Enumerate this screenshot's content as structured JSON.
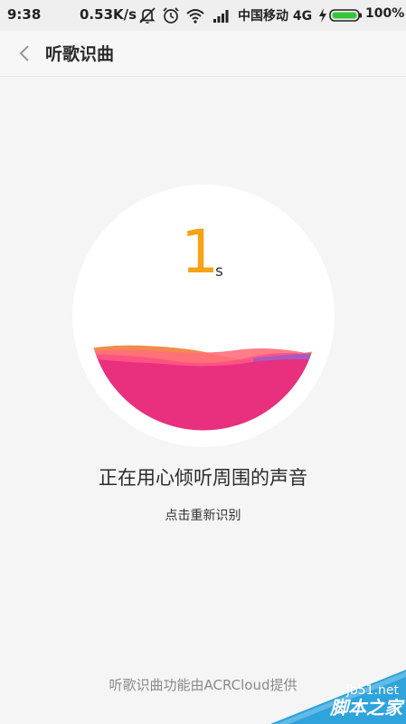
{
  "status_bar": {
    "time": "9:38",
    "net_speed": "0.53K/s",
    "carrier": "中国移动 4G",
    "battery": "100%",
    "icons": [
      "bell-off-icon",
      "alarm-icon",
      "wifi-icon",
      "signal-icon",
      "charging-icon",
      "battery-icon"
    ]
  },
  "header": {
    "back_icon": "chevron-left-icon",
    "title": "听歌识曲"
  },
  "recognizer": {
    "countdown": "1",
    "unit": "s",
    "status": "正在用心倾听周围的声音",
    "retry": "点击重新识别",
    "wave_color": "#e8307f",
    "accent_color": "#f5a217"
  },
  "footer": {
    "credit": "听歌识曲功能由ACRCloud提供"
  },
  "watermark": {
    "site": "jb51.net",
    "name": "脚本之家"
  }
}
